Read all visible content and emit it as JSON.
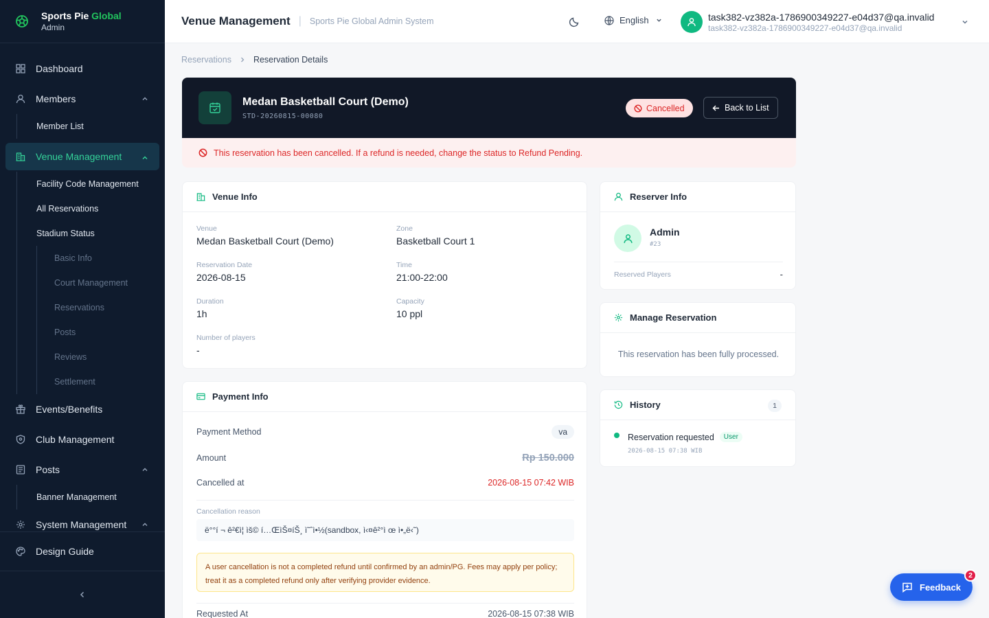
{
  "brand": {
    "name_main": "Sports Pie",
    "name_accent": "Global",
    "role": "Admin"
  },
  "sidebar": {
    "items": [
      {
        "label": "Dashboard",
        "icon": "dashboard-icon"
      },
      {
        "label": "Members",
        "icon": "user-icon"
      },
      {
        "label": "Member List"
      },
      {
        "label": "Venue Management",
        "icon": "building-icon"
      },
      {
        "label": "Facility Code Management"
      },
      {
        "label": "All Reservations"
      },
      {
        "label": "Stadium Status"
      },
      {
        "label": "Basic Info"
      },
      {
        "label": "Court Management"
      },
      {
        "label": "Reservations"
      },
      {
        "label": "Posts"
      },
      {
        "label": "Reviews"
      },
      {
        "label": "Settlement"
      },
      {
        "label": "Events/Benefits",
        "icon": "gift-icon"
      },
      {
        "label": "Club Management",
        "icon": "shield-icon"
      },
      {
        "label": "Posts",
        "icon": "posts-icon"
      },
      {
        "label": "Banner Management"
      },
      {
        "label": "System Management",
        "icon": "gear-icon"
      }
    ],
    "design_guide": "Design Guide"
  },
  "header": {
    "title": "Venue Management",
    "subtitle": "Sports Pie Global Admin System",
    "language": "English",
    "user_name": "task382-vz382a-1786900349227-e04d37@qa.invalid",
    "user_email": "task382-vz382a-1786900349227-e04d37@qa.invalid"
  },
  "breadcrumb": {
    "parent": "Reservations",
    "current": "Reservation Details"
  },
  "hero": {
    "title": "Medan Basketball Court (Demo)",
    "code": "STD-20260815-00080",
    "status": "Cancelled",
    "back_label": "Back to List"
  },
  "alert": "This reservation has been cancelled. If a refund is needed, change the status to Refund Pending.",
  "venue_info": {
    "title": "Venue Info",
    "venue_label": "Venue",
    "venue": "Medan Basketball Court (Demo)",
    "zone_label": "Zone",
    "zone": "Basketball Court 1",
    "date_label": "Reservation Date",
    "date": "2026-08-15",
    "time_label": "Time",
    "time": "21:00-22:00",
    "duration_label": "Duration",
    "duration": "1h",
    "capacity_label": "Capacity",
    "capacity": "10 ppl",
    "players_label": "Number of players",
    "players": "-"
  },
  "payment_info": {
    "title": "Payment Info",
    "method_label": "Payment Method",
    "method": "va",
    "amount_label": "Amount",
    "amount": "Rp 150.000",
    "cancelled_label": "Cancelled at",
    "cancelled_at": "2026-08-15 07:42 WIB",
    "reason_label": "Cancellation reason",
    "reason": "ë°°í    ¬ ê²€ì¦   ìš© í…ŒìŠ¤íŠ¸ ì˜ˆì•½(sandbox, ì‹¤ê²°ì œ ì•„ë‹˜)",
    "warning": "A user cancellation is not a completed refund until confirmed by an admin/PG. Fees may apply per policy; treat it as a completed refund only after verifying provider evidence.",
    "requested_label": "Requested At",
    "requested_at": "2026-08-15 07:38 WIB"
  },
  "reserver_info": {
    "title": "Reserver Info",
    "name": "Admin",
    "id": "#23",
    "players_label": "Reserved Players",
    "players": "-"
  },
  "manage": {
    "title": "Manage Reservation",
    "message": "This reservation has been fully processed."
  },
  "history": {
    "title": "History",
    "count": "1",
    "entries": [
      {
        "label": "Reservation requested",
        "tag": "User",
        "time": "2026-08-15 07:38 WIB"
      }
    ]
  },
  "feedback": {
    "label": "Feedback",
    "count": "2"
  },
  "colors": {
    "accent": "#10b981",
    "sidebar_bg": "#0f1b2d",
    "danger": "#dc2626",
    "primary": "#2563eb"
  }
}
